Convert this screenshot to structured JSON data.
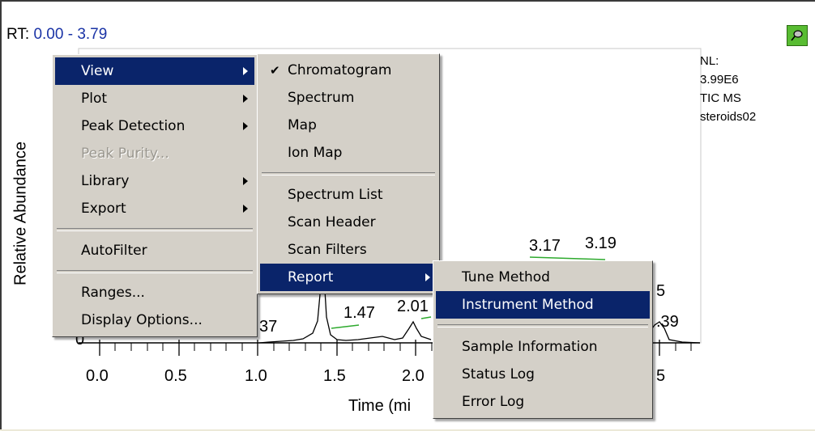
{
  "header": {
    "rt_label": "RT:",
    "rt_value": "0.00 - 3.79"
  },
  "pin_icon": "pushpin-icon",
  "info": {
    "nl_label": "NL:",
    "nl_value": "3.99E6",
    "trace": "TIC  MS",
    "file": "steroids02"
  },
  "axes": {
    "ylabel": "Relative Abundance",
    "xlabel": "Time (mi",
    "x_ticks": [
      "0.0",
      "0.5",
      "1.0",
      "1.5",
      "2.0",
      "5"
    ],
    "y_zero": "0"
  },
  "peaks": {
    "p317": "3.17",
    "p319": "3.19",
    "p147": "1.47",
    "p201": "2.01",
    "p37": "37",
    "p39": ".39",
    "p5": "5"
  },
  "menu_main": {
    "items": [
      {
        "label": "View"
      },
      {
        "label": "Plot"
      },
      {
        "label": "Peak Detection"
      },
      {
        "label": "Peak Purity..."
      },
      {
        "label": "Library"
      },
      {
        "label": "Export"
      },
      {
        "label": "AutoFilter"
      },
      {
        "label": "Ranges..."
      },
      {
        "label": "Display Options..."
      }
    ]
  },
  "menu_view": {
    "items": [
      {
        "label": "Chromatogram"
      },
      {
        "label": "Spectrum"
      },
      {
        "label": "Map"
      },
      {
        "label": "Ion Map"
      },
      {
        "label": "Spectrum List"
      },
      {
        "label": "Scan Header"
      },
      {
        "label": "Scan Filters"
      },
      {
        "label": "Report"
      }
    ]
  },
  "menu_report": {
    "items": [
      {
        "label": "Tune Method"
      },
      {
        "label": "Instrument Method"
      },
      {
        "label": "Sample Information"
      },
      {
        "label": "Status Log"
      },
      {
        "label": "Error Log"
      }
    ]
  },
  "colors": {
    "highlight": "#0a246a",
    "menu_bg": "#d4d0c8",
    "rt_value": "#1a33a6",
    "pin_bg": "#58bc32"
  }
}
